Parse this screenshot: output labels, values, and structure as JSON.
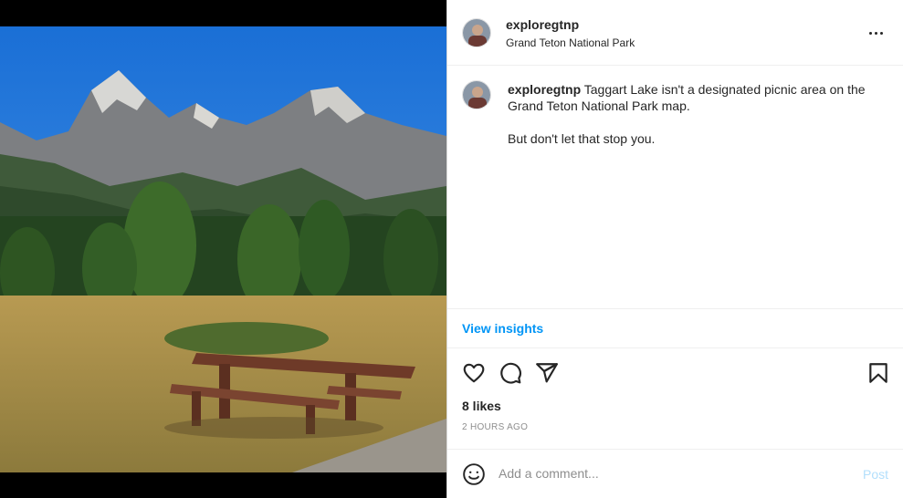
{
  "post": {
    "username": "exploregtnp",
    "location": "Grand Teton National Park",
    "caption_line1": "Taggart Lake isn't a designated picnic area on the Grand Teton National Park map.",
    "caption_line2": "But don't let that stop you.",
    "view_insights": "View insights",
    "likes": "8 likes",
    "timestamp": "2 HOURS AGO"
  },
  "comment_box": {
    "placeholder": "Add a comment...",
    "post_label": "Post"
  },
  "icons": {
    "more": "more-options-icon",
    "like": "heart-icon",
    "comment": "comment-icon",
    "share": "share-icon",
    "save": "bookmark-icon",
    "emoji": "emoji-icon"
  },
  "colors": {
    "link": "#0095f6",
    "post_disabled": "#b2dffc",
    "text": "#262626",
    "muted": "#8e8e8e"
  }
}
